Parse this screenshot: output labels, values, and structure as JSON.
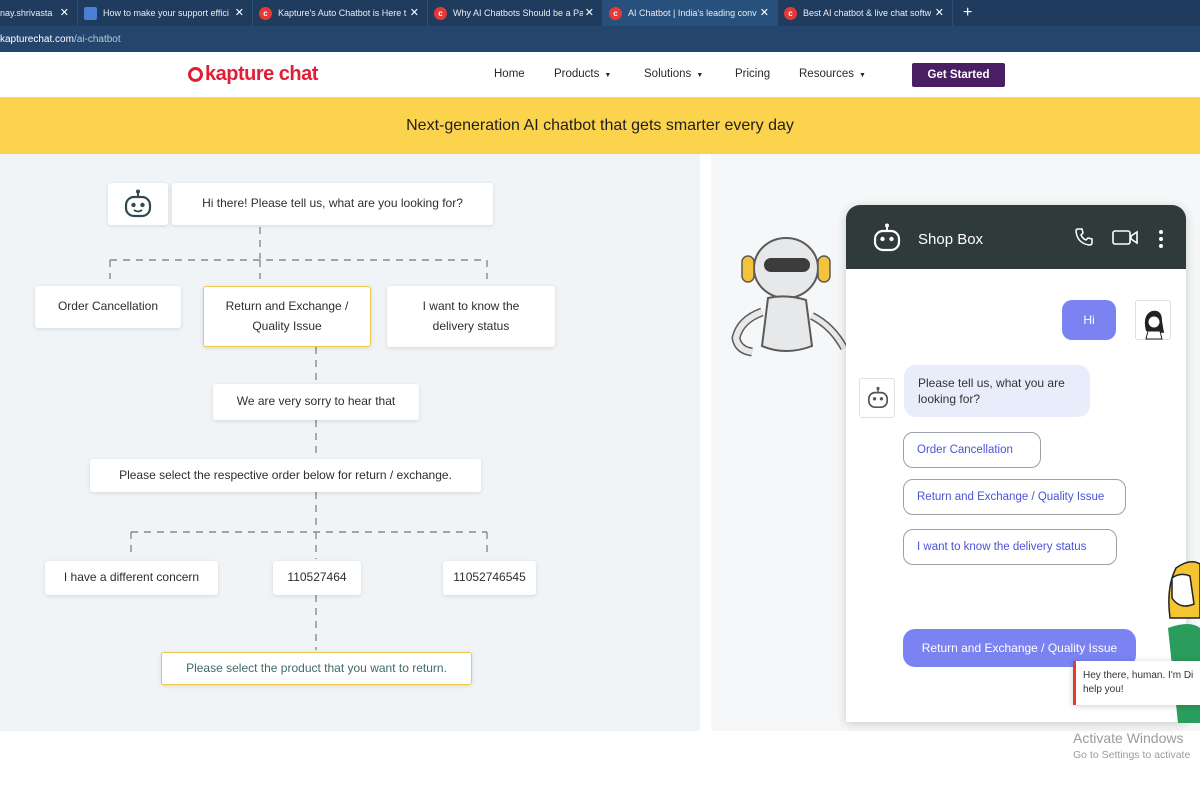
{
  "browser": {
    "tabs": [
      {
        "label": "nay.shrivasta",
        "icon": "none",
        "active": false
      },
      {
        "label": "How to make your support effici",
        "icon": "docs-icon",
        "active": false
      },
      {
        "label": "Kapture's Auto Chatbot is Here t",
        "icon": "kapture-icon",
        "active": false
      },
      {
        "label": "Why AI Chatbots Should be a Pa",
        "icon": "kapture-icon",
        "active": false
      },
      {
        "label": "AI Chatbot | India's leading conv",
        "icon": "kapture-icon",
        "active": true
      },
      {
        "label": "Best AI chatbot & live chat softw",
        "icon": "kapture-icon",
        "active": false
      }
    ],
    "close_glyph": "✕",
    "new_tab": "+",
    "address_host": "kapturechat.com",
    "address_path": "/ai-chatbot"
  },
  "nav": {
    "logo": "kapture chat",
    "items": [
      "Home",
      "Products",
      "Solutions",
      "Pricing",
      "Resources"
    ],
    "cta": "Get Started"
  },
  "banner": {
    "text": "Next-generation AI chatbot that gets smarter every day"
  },
  "flow": {
    "greeting": "Hi there! Please tell us, what are you looking for?",
    "options": [
      "Order Cancellation",
      "Return and Exchange / Quality Issue",
      "I want to know the delivery status"
    ],
    "sorry": "We are very sorry to hear that",
    "select_order": "Please select the respective order below for return / exchange.",
    "orders": [
      "I have a different concern",
      "110527464",
      "11052746545"
    ],
    "select_product": "Please select the product that you want to return."
  },
  "chat": {
    "title": "Shop Box",
    "user_msg": "Hi",
    "bot_msg": "Please tell us, what you are looking for?",
    "options": [
      "Order Cancellation",
      "Return and Exchange / Quality Issue",
      "I want to know the delivery status"
    ],
    "selected": "Return and Exchange / Quality Issue",
    "popup": "Hey there, human. I'm Di help you!"
  },
  "watermark": {
    "title": "Activate Windows",
    "subtitle": "Go to Settings to activate"
  },
  "colors": {
    "tabbar": "#1f3c5e",
    "brand_red": "#e01e37",
    "cta": "#4a1e63",
    "banner": "#fcd34d",
    "chat_accent": "#7b83f3",
    "option_text": "#4b53d8"
  }
}
